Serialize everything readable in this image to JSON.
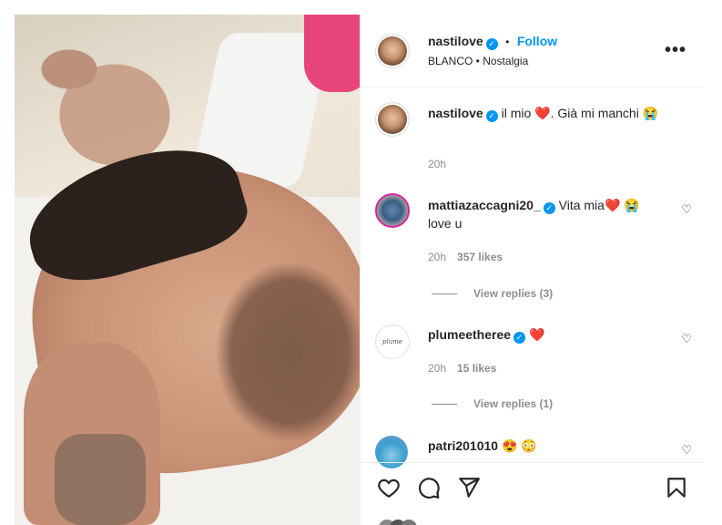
{
  "post": {
    "username": "nastilove",
    "follow_label": "Follow",
    "separator": "•",
    "audio": "BLANCO • Nostalgia",
    "more_icon": "more-icon"
  },
  "caption": {
    "username": "nastilove",
    "text": "il mio ❤️. Già mi manchi 😭",
    "time": "20h"
  },
  "comments": [
    {
      "username": "mattiazaccagni20_",
      "text": "Vita mia❤️ 😭 love u",
      "time": "20h",
      "likes": "357 likes",
      "replies": "View replies (3)"
    },
    {
      "username": "plumeetheree",
      "text": "❤️",
      "time": "20h",
      "likes": "15 likes",
      "replies": "View replies (1)",
      "avatar_text": "plume"
    },
    {
      "username": "patri201010",
      "text": "😍 😳"
    }
  ],
  "colors": {
    "accent": "#0095f6",
    "heart": "#ed4956",
    "text": "#262626",
    "muted": "#8e8e8e"
  }
}
